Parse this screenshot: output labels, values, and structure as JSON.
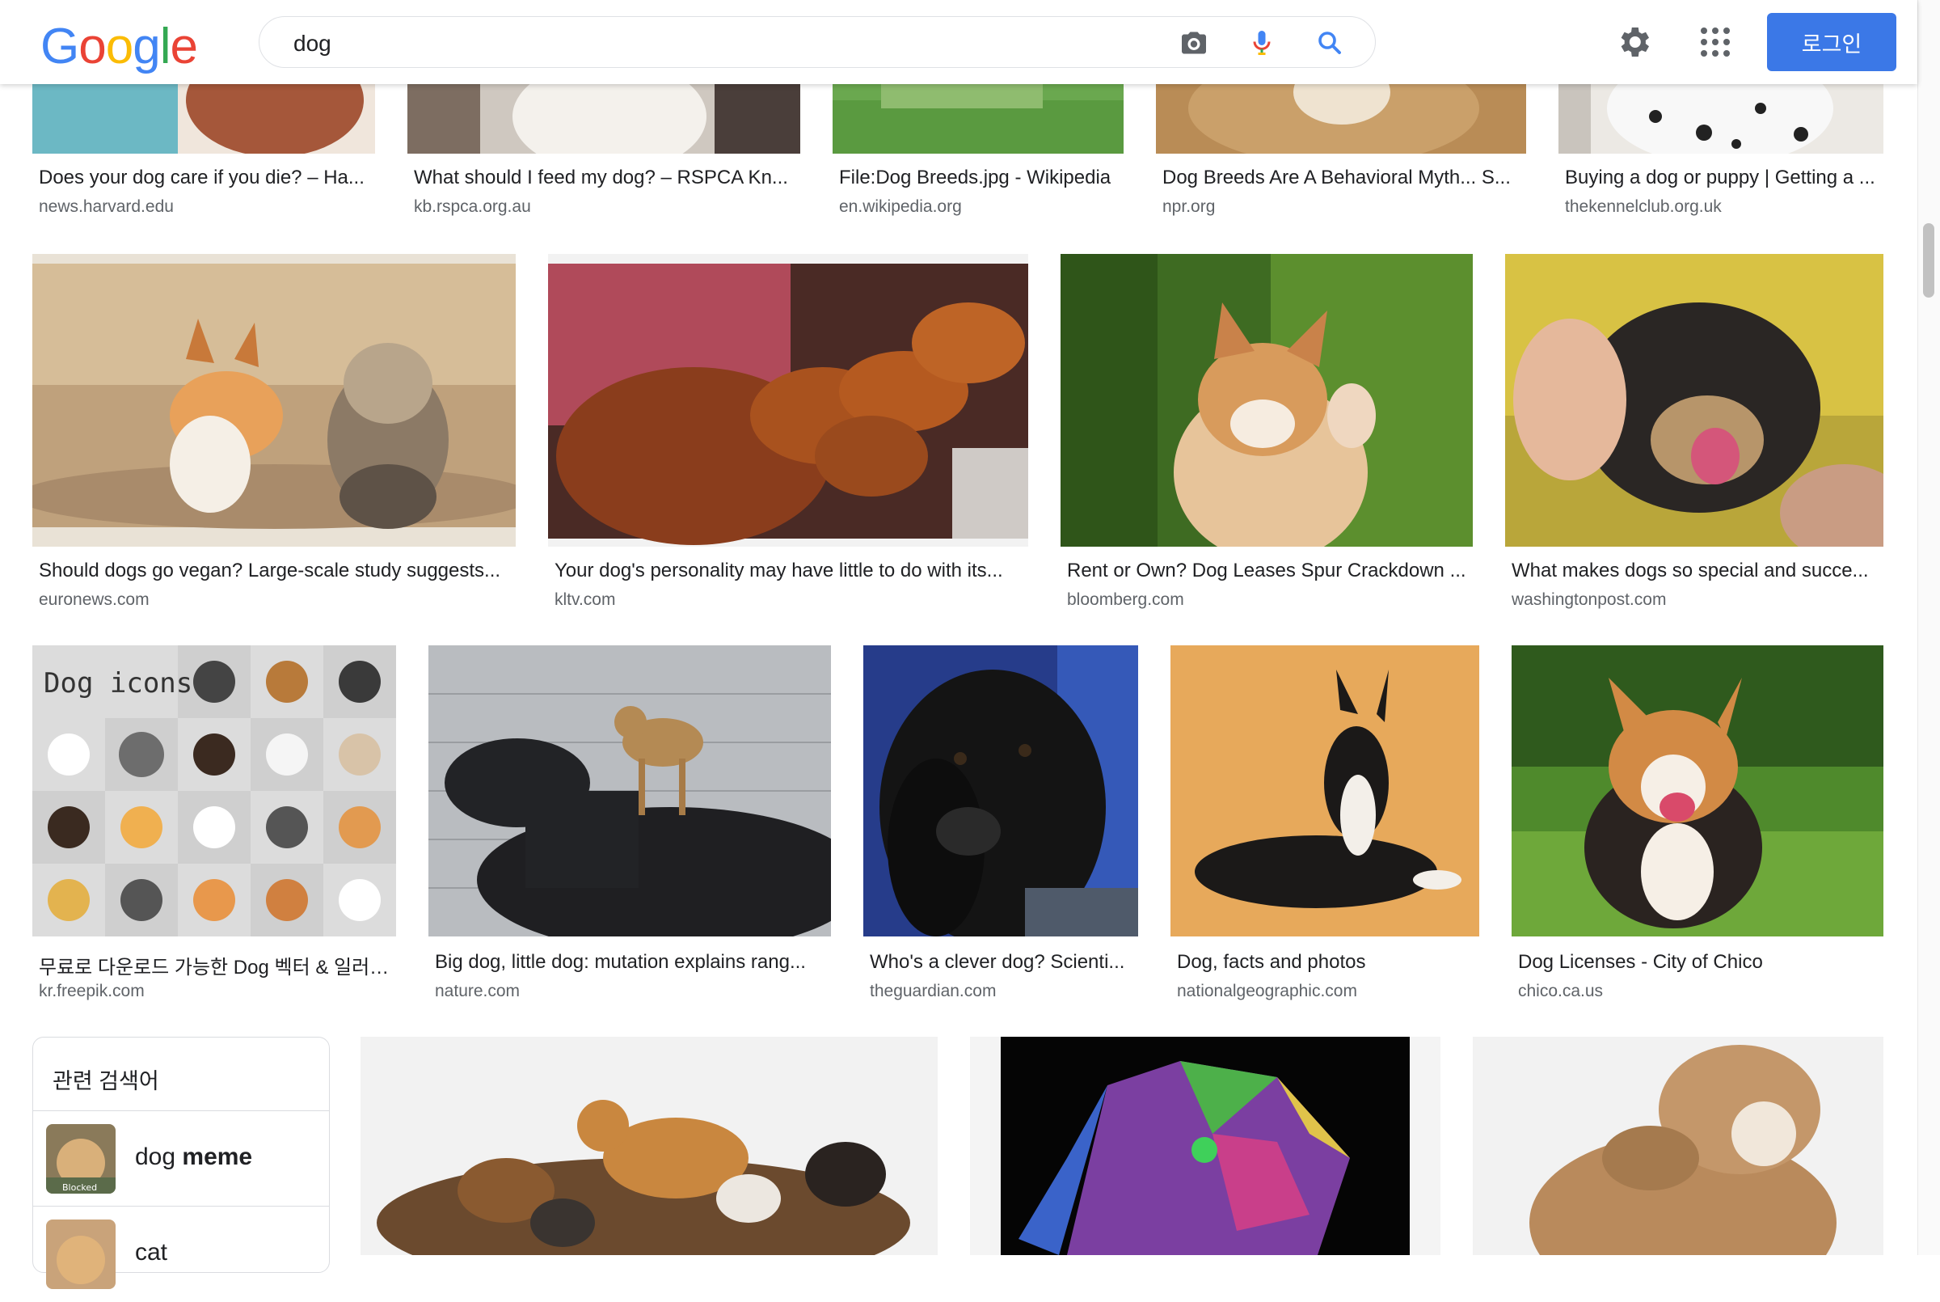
{
  "header": {
    "logo_letters": [
      {
        "ch": "G",
        "color": "#4285F4"
      },
      {
        "ch": "o",
        "color": "#EA4335"
      },
      {
        "ch": "o",
        "color": "#FBBC05"
      },
      {
        "ch": "g",
        "color": "#4285F4"
      },
      {
        "ch": "l",
        "color": "#34A853"
      },
      {
        "ch": "e",
        "color": "#EA4335"
      }
    ],
    "search_value": "dog",
    "login_label": "로그인",
    "icons": [
      "camera-icon",
      "microphone-icon",
      "search-icon",
      "gear-icon",
      "apps-grid-icon"
    ]
  },
  "results_row1": [
    {
      "title": "Does your dog care if you die? – Ha...",
      "source": "news.harvard.edu"
    },
    {
      "title": "What should I feed my dog? – RSPCA Kn...",
      "source": "kb.rspca.org.au"
    },
    {
      "title": "File:Dog Breeds.jpg - Wikipedia",
      "source": "en.wikipedia.org"
    },
    {
      "title": "Dog Breeds Are A Behavioral Myth... S...",
      "source": "npr.org"
    },
    {
      "title": "Buying a dog or puppy | Getting a ...",
      "source": "thekennelclub.org.uk"
    }
  ],
  "results_row2": [
    {
      "title": "Should dogs go vegan? Large-scale study suggests...",
      "source": "euronews.com"
    },
    {
      "title": "Your dog's personality may have little to do with its...",
      "source": "kltv.com"
    },
    {
      "title": "Rent or Own? Dog Leases Spur Crackdown ...",
      "source": "bloomberg.com"
    },
    {
      "title": "What makes dogs so special and succe...",
      "source": "washingtonpost.com"
    }
  ],
  "results_row3": [
    {
      "title": "무료로 다운로드 가능한 Dog 벡터 & 일러스...",
      "source": "kr.freepik.com",
      "image_text": "Dog icons"
    },
    {
      "title": "Big dog, little dog: mutation explains rang...",
      "source": "nature.com"
    },
    {
      "title": "Who's a clever dog? Scienti...",
      "source": "theguardian.com"
    },
    {
      "title": "Dog, facts and photos",
      "source": "nationalgeographic.com"
    },
    {
      "title": "Dog Licenses - City of Chico",
      "source": "chico.ca.us"
    }
  ],
  "related": {
    "title": "관련 검색어",
    "items": [
      {
        "prefix": "dog ",
        "bold": "meme",
        "thumb_badge": "Blocked"
      },
      {
        "prefix": "cat",
        "bold": ""
      }
    ]
  },
  "colors": {
    "accent": "#3b78e7",
    "text": "#202124",
    "secondary": "#5f6368",
    "border": "#dfe1e5"
  }
}
